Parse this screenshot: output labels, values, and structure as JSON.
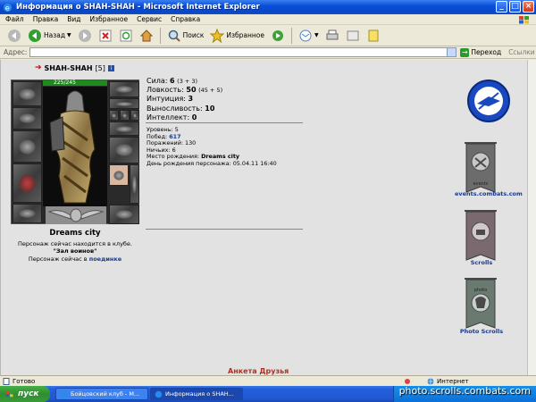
{
  "window": {
    "title": "Информация о SHAH-SHAH - Microsoft Internet Explorer",
    "minimize": "_",
    "maximize": "□",
    "close": "×"
  },
  "menu": [
    "Файл",
    "Правка",
    "Вид",
    "Избранное",
    "Сервис",
    "Справка"
  ],
  "toolbar": {
    "back": "Назад",
    "search": "Поиск",
    "favorites": "Избранное"
  },
  "address": {
    "label": "Адрес:",
    "value": "",
    "go": "Переход",
    "links": "Ссылки"
  },
  "character": {
    "name": "SHAH-SHAH",
    "level_badge": "[5]",
    "hp": "225/245",
    "location_title": "Dreams city",
    "location_line1": "Персонаж сейчас находится в клубе.",
    "location_line2": "\"Зал воинов\"",
    "location_line3_prefix": "Персонаж сейчас в ",
    "location_line3_link": "поединке"
  },
  "stats": [
    {
      "label": "Сила:",
      "value": "6",
      "mod": "(3 + 3)"
    },
    {
      "label": "Ловкость:",
      "value": "50",
      "mod": "(45 + 5)"
    },
    {
      "label": "Интуиция:",
      "value": "3",
      "mod": ""
    },
    {
      "label": "Выносливость:",
      "value": "10",
      "mod": ""
    },
    {
      "label": "Интеллект:",
      "value": "0",
      "mod": ""
    }
  ],
  "info": {
    "level": "Уровень: 5",
    "wins_label": "Побед: ",
    "wins_value": "617",
    "losses": "Поражений: 130",
    "draws": "Ничьих: 6",
    "birthplace_label": "Место рождения: ",
    "birthplace_value": "Dreams city",
    "birthday": "День рождения персонажа: 05.04.11 16:40"
  },
  "ads": [
    {
      "label": "events.combats.com",
      "caption": "events"
    },
    {
      "label": "Scrolls",
      "caption": ""
    },
    {
      "label": "Photo Scrolls",
      "caption": "photo"
    }
  ],
  "footer_cut": "Анкета Друзья",
  "status": {
    "ready": "Готово",
    "zone": "Интернет"
  },
  "taskbar": {
    "start": "пуск",
    "tasks": [
      "Бойцовский клуб - M...",
      "Информация о SHAH..."
    ]
  },
  "watermark": "photo.scrolls.combats.com",
  "colors": {
    "title_bar": "#0a4ed8",
    "content_bg": "#e2e2e2",
    "hp_green": "#1e8a1e",
    "link_blue": "#1a3a8a"
  }
}
